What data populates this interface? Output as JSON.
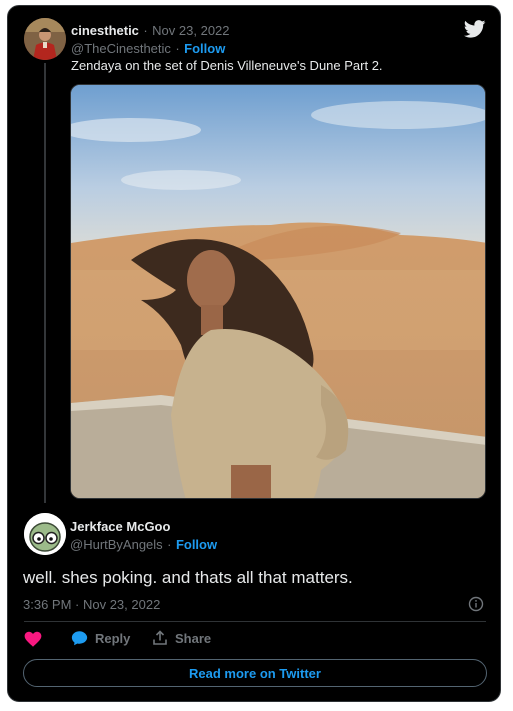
{
  "parent_tweet": {
    "display_name": "cinesthetic",
    "date": "Nov 23, 2022",
    "handle": "@TheCinesthetic",
    "follow_label": "Follow",
    "text": "Zendaya on the set of Denis Villeneuve's Dune Part 2."
  },
  "reply_tweet": {
    "display_name": "Jerkface McGoo",
    "handle": "@HurtByAngels",
    "follow_label": "Follow",
    "text": "well. shes poking. and thats all that matters.",
    "timestamp": "3:36 PM · Nov 23, 2022"
  },
  "actions": {
    "reply_label": "Reply",
    "share_label": "Share"
  },
  "read_more_label": "Read more on Twitter",
  "separator": "·",
  "colors": {
    "background": "#000000",
    "accent": "#1d9bf0",
    "text": "#e7e9ea",
    "muted": "#71767b",
    "like": "#f91880"
  },
  "icons": [
    "twitter-bird-icon",
    "heart-icon",
    "reply-bubble-icon",
    "share-icon",
    "info-icon"
  ]
}
